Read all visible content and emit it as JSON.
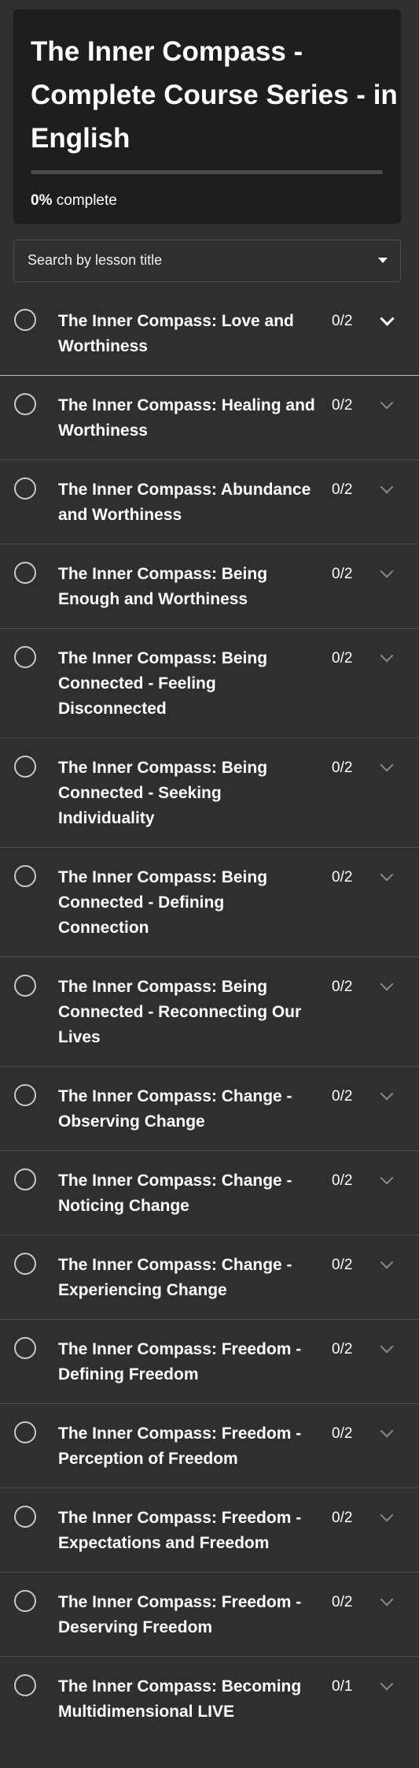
{
  "course": {
    "title": "The Inner Compass - Complete Course Series - in English",
    "progress_percent": 0,
    "progress_value": "0%",
    "progress_suffix": "complete"
  },
  "search": {
    "placeholder": "Search by lesson title"
  },
  "lessons": [
    {
      "title": "The Inner Compass: Love and Worthiness",
      "count": "0/2",
      "expanded": true
    },
    {
      "title": "The Inner Compass: Healing and Worthiness",
      "count": "0/2"
    },
    {
      "title": "The Inner Compass: Abundance and Worthiness",
      "count": "0/2"
    },
    {
      "title": "The Inner Compass: Being Enough and Worthiness",
      "count": "0/2"
    },
    {
      "title": "The Inner Compass: Being Connected - Feeling Disconnected",
      "count": "0/2"
    },
    {
      "title": "The Inner Compass: Being Connected - Seeking Individuality",
      "count": "0/2"
    },
    {
      "title": "The Inner Compass: Being Connected - Defining Connection",
      "count": "0/2"
    },
    {
      "title": "The Inner Compass: Being Connected - Reconnecting Our Lives",
      "count": "0/2"
    },
    {
      "title": "The Inner Compass: Change - Observing Change",
      "count": "0/2"
    },
    {
      "title": "The Inner Compass: Change - Noticing Change",
      "count": "0/2"
    },
    {
      "title": "The Inner Compass: Change - Experiencing Change",
      "count": "0/2"
    },
    {
      "title": "The Inner Compass: Freedom - Defining Freedom",
      "count": "0/2"
    },
    {
      "title": "The Inner Compass: Freedom - Perception of Freedom",
      "count": "0/2"
    },
    {
      "title": "The Inner Compass: Freedom - Expectations and Freedom",
      "count": "0/2"
    },
    {
      "title": "The Inner Compass: Freedom - Deserving Freedom",
      "count": "0/2"
    },
    {
      "title": "The Inner Compass: Becoming Multidimensional LIVE",
      "count": "0/1"
    }
  ],
  "colors": {
    "background": "#2f2f2f",
    "header_card": "#1e1e1e",
    "text": "#ffffff",
    "divider": "#4a4a4a"
  },
  "icons": {
    "status": "empty-circle-icon",
    "expand": "chevron-down-icon",
    "dropdown": "caret-down-icon"
  }
}
